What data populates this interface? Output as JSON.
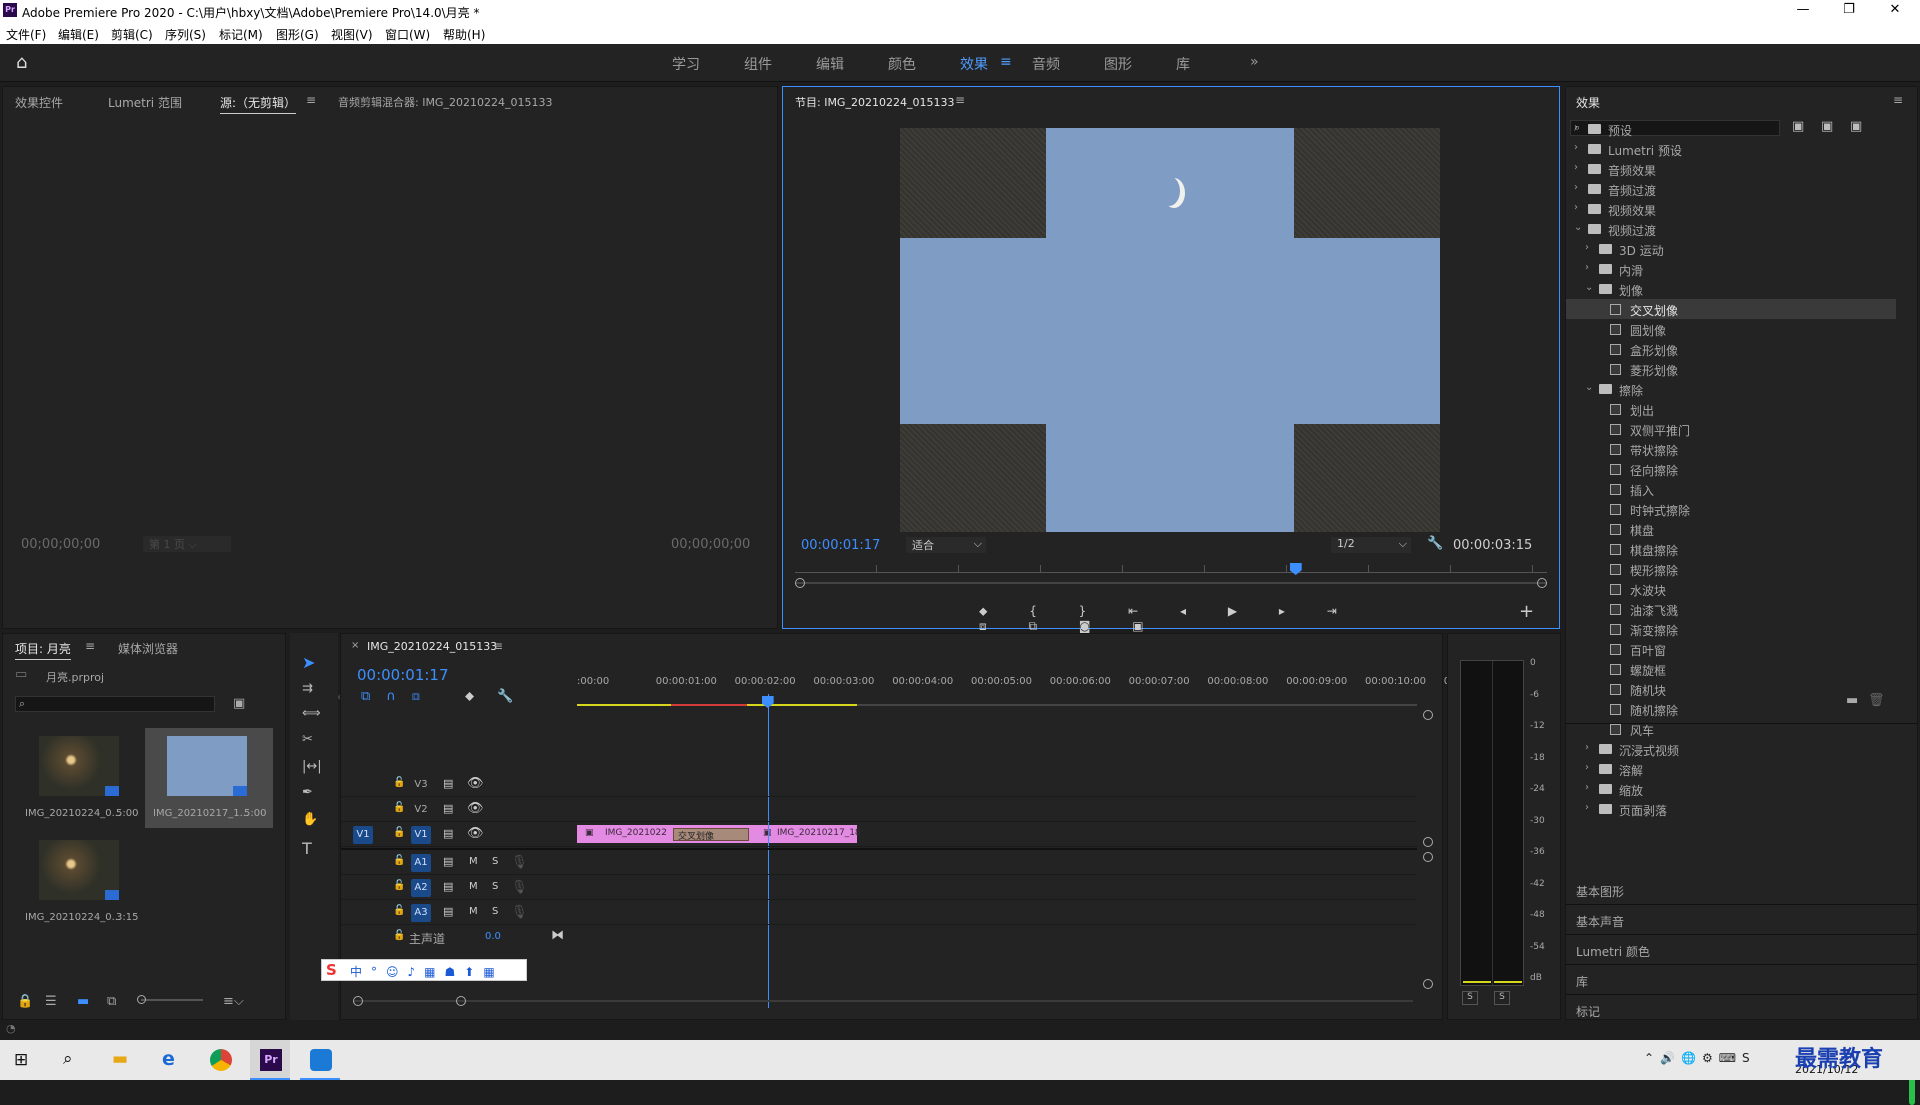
{
  "window": {
    "title": "Adobe Premiere Pro 2020 - C:\\用户\\hbxy\\文档\\Adobe\\Premiere Pro\\14.0\\月亮 *",
    "logo": "Pr"
  },
  "menu": [
    "文件(F)",
    "编辑(E)",
    "剪辑(C)",
    "序列(S)",
    "标记(M)",
    "图形(G)",
    "视图(V)",
    "窗口(W)",
    "帮助(H)"
  ],
  "workspaces": [
    "学习",
    "组件",
    "编辑",
    "颜色",
    "效果",
    "音频",
    "图形",
    "库"
  ],
  "active_workspace": "效果",
  "source_panel": {
    "tabs": [
      "效果控件",
      "Lumetri 范围",
      "源:（无剪辑）",
      "音频剪辑混合器: IMG_20210224_015133"
    ],
    "timecode_left": "00;00;00;00",
    "timecode_right": "00;00;00;00",
    "page": "第 1 页"
  },
  "program_panel": {
    "title": "节目: IMG_20210224_015133",
    "timecode": "00:00:01:17",
    "fit": "适合",
    "quality": "1/2",
    "duration": "00:00:03:15"
  },
  "effects_panel": {
    "title": "效果",
    "search_placeholder": "",
    "top_items": [
      "预设",
      "Lumetri 预设",
      "音频效果",
      "音频过渡",
      "视频效果",
      "视频过渡"
    ],
    "video_transition_children": [
      "3D 运动",
      "内滑",
      "划像"
    ],
    "iris_items": [
      "交叉划像",
      "圆划像",
      "盒形划像",
      "菱形划像"
    ],
    "wipe_folder": "擦除",
    "wipe_items": [
      "划出",
      "双侧平推门",
      "带状擦除",
      "径向擦除",
      "插入",
      "时钟式擦除",
      "棋盘",
      "棋盘擦除",
      "楔形擦除",
      "水波块",
      "油漆飞溅",
      "渐变擦除",
      "百叶窗",
      "螺旋框",
      "随机块",
      "随机擦除",
      "风车"
    ],
    "after_items": [
      "沉浸式视频",
      "溶解",
      "缩放",
      "页面剥落"
    ],
    "sections": [
      "基本图形",
      "基本声音",
      "Lumetri 颜色",
      "库",
      "标记"
    ]
  },
  "project_panel": {
    "tabs": [
      "项目: 月亮",
      "媒体浏览器"
    ],
    "file": "月亮.prproj",
    "items": [
      {
        "name": "IMG_20210224_0...",
        "duration": "5:00"
      },
      {
        "name": "IMG_20210217_1...",
        "duration": "5:00"
      },
      {
        "name": "IMG_20210224_0...",
        "duration": "3:15"
      }
    ]
  },
  "timeline": {
    "tab": "IMG_20210224_015133",
    "timecode": "00:00:01:17",
    "ruler": [
      ":00:00",
      "00:00:01:00",
      "00:00:02:00",
      "00:00:03:00",
      "00:00:04:00",
      "00:00:05:00",
      "00:00:06:00",
      "00:00:07:00",
      "00:00:08:00",
      "00:00:09:00",
      "00:00:10:00",
      "0"
    ],
    "video_tracks": [
      "V3",
      "V2",
      "V1"
    ],
    "audio_tracks": [
      "A1",
      "A2",
      "A3"
    ],
    "master": "主声道",
    "master_value": "0.0",
    "clips": [
      "IMG_2021022",
      "交叉划像",
      "IMG_20210217_18"
    ],
    "playhead_fraction": 0.227,
    "track_m": "M",
    "track_s": "S"
  },
  "meter": {
    "labels": [
      "0",
      "-6",
      "-12",
      "-18",
      "-24",
      "-30",
      "-36",
      "-42",
      "-48",
      "-54",
      "dB"
    ],
    "solo": [
      "S",
      "S"
    ]
  },
  "taskbar": {
    "time": "2021/10/12",
    "brand": "最需教育"
  },
  "colors": {
    "accent": "#3d8fff",
    "clip": "#e38ae3",
    "bg": "#1d1d1d",
    "sky": "#7f9cc5"
  }
}
